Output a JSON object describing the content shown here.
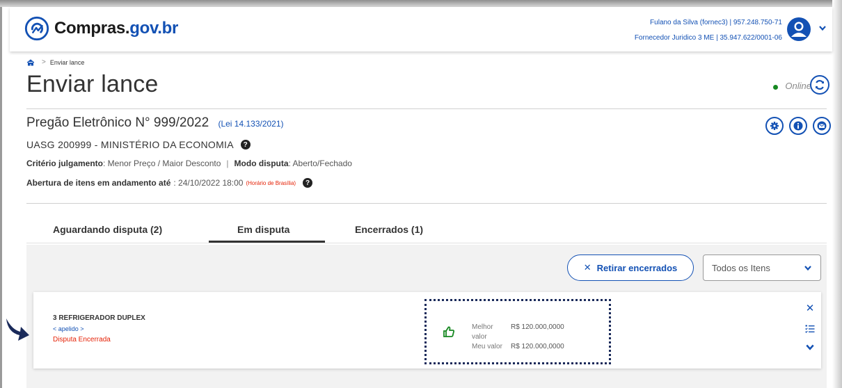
{
  "header": {
    "logo_text": "Compras.",
    "logo_text_suffix": "gov.br",
    "user_line1": "Fulano da Silva (fornec3) | 957.248.750-71",
    "user_line2": "Fornecedor Juridico 3 ME | 35.947.622/0001-06"
  },
  "breadcrumb": {
    "current": "Enviar lance"
  },
  "page": {
    "title": "Enviar lance",
    "status": "Online"
  },
  "pregao": {
    "title": "Pregão Eletrônico N° 999/2022",
    "lei": "(Lei 14.133/2021)",
    "uasg": "UASG 200999 - MINISTÉRIO DA ECONOMIA",
    "criterio_label": "Critério julgamento",
    "criterio_value": ": Menor Preço / Maior Desconto",
    "modo_label": "Modo disputa",
    "modo_value": ": Aberto/Fechado",
    "abertura_label": "Abertura de itens em andamento até",
    "abertura_value": ": 24/10/2022 18:00",
    "horario": "(Horário de Brasília)"
  },
  "tabs": [
    {
      "label": "Aguardando disputa (2)"
    },
    {
      "label": "Em disputa"
    },
    {
      "label": "Encerrados (1)"
    }
  ],
  "toolbar": {
    "retirar_label": "Retirar encerrados",
    "filter_value": "Todos os Itens"
  },
  "item": {
    "title": "3  REFRIGERADOR DUPLEX",
    "apelido": "< apelido >",
    "status": "Disputa Encerrada",
    "melhor_label": "Melhor valor",
    "melhor_value": "R$ 120.000,0000",
    "meu_label": "Meu valor",
    "meu_value": "R$ 120.000,0000"
  },
  "colors": {
    "primary": "#1351b4",
    "danger": "#e52207",
    "success": "#168821"
  },
  "icons": [
    "home-icon",
    "question-icon",
    "gear-icon",
    "info-icon",
    "mail-icon",
    "refresh-icon",
    "user-icon",
    "thumbs-up-icon",
    "close-icon",
    "list-icon",
    "chevron-down-icon",
    "arrow-icon"
  ]
}
